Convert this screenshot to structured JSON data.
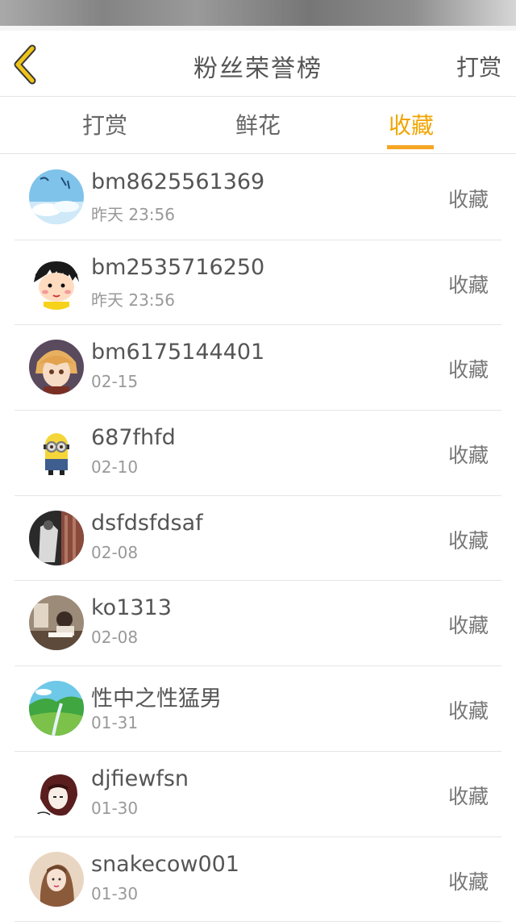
{
  "header": {
    "title": "粉丝荣誉榜",
    "right_label": "打赏",
    "back_icon": "chevron-left-icon"
  },
  "tabs": [
    {
      "label": "打赏",
      "active": false
    },
    {
      "label": "鲜花",
      "active": false
    },
    {
      "label": "收藏",
      "active": true
    }
  ],
  "colors": {
    "accent": "#f5a623",
    "back_icon": "#f0c419"
  },
  "items": [
    {
      "name": "bm8625561369",
      "time": "昨天 23:56",
      "action": "收藏",
      "avatar": "sky-avatar"
    },
    {
      "name": "bm2535716250",
      "time": "昨天 23:56",
      "action": "收藏",
      "avatar": "cartoon-girl-avatar"
    },
    {
      "name": "bm6175144401",
      "time": "02-15",
      "action": "收藏",
      "avatar": "anime-boy-avatar"
    },
    {
      "name": "687fhfd",
      "time": "02-10",
      "action": "收藏",
      "avatar": "minion-avatar"
    },
    {
      "name": "dsfdsfdsaf",
      "time": "02-08",
      "action": "收藏",
      "avatar": "dark-photo-avatar"
    },
    {
      "name": "ko1313",
      "time": "02-08",
      "action": "收藏",
      "avatar": "reading-avatar"
    },
    {
      "name": "性中之性猛男",
      "time": "01-31",
      "action": "收藏",
      "avatar": "landscape-avatar"
    },
    {
      "name": "djfiewfsn",
      "time": "01-30",
      "action": "收藏",
      "avatar": "sketch-girl-avatar"
    },
    {
      "name": "snakecow001",
      "time": "01-30",
      "action": "收藏",
      "avatar": "girl-photo-avatar"
    }
  ]
}
